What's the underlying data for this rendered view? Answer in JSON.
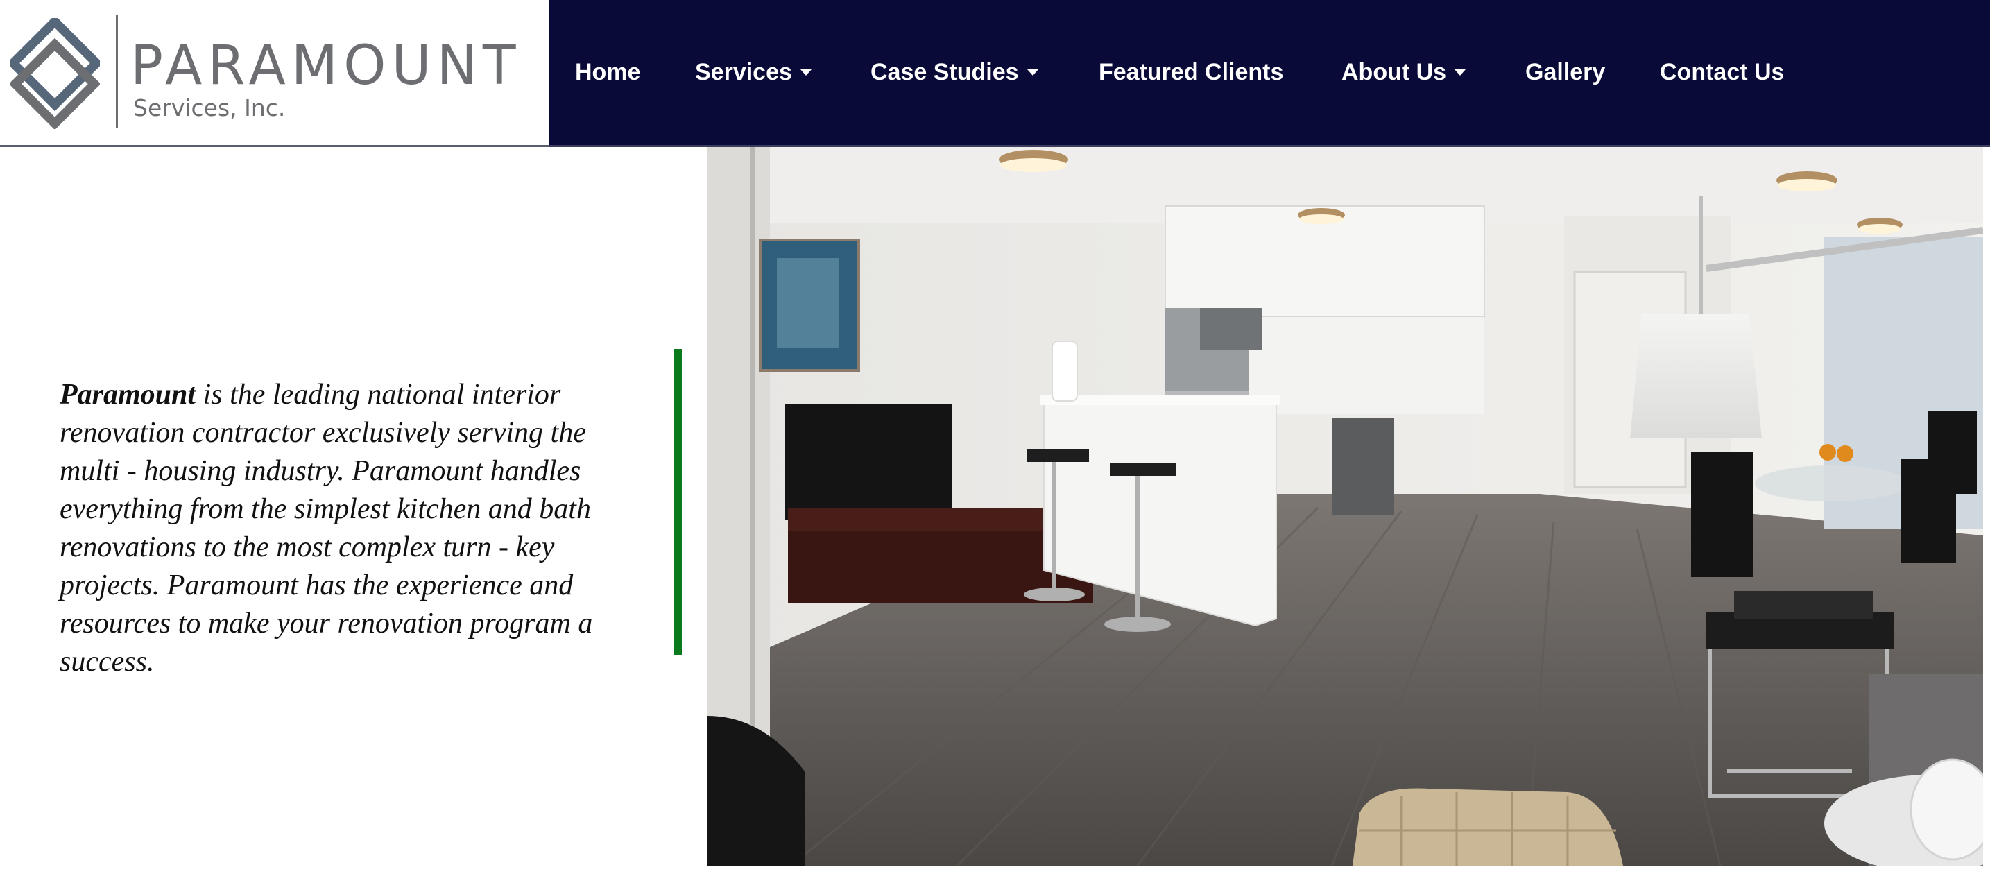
{
  "brand": {
    "name": "PARAMOUNT",
    "subtitle": "Services, Inc.",
    "colors": {
      "logo_gray": "#6d6e71",
      "nav_bg": "#0a0a39",
      "accent_green": "#0a7a1c"
    }
  },
  "nav": {
    "items": [
      {
        "label": "Home",
        "has_dropdown": false
      },
      {
        "label": "Services",
        "has_dropdown": true
      },
      {
        "label": "Case Studies",
        "has_dropdown": true
      },
      {
        "label": "Featured Clients",
        "has_dropdown": false
      },
      {
        "label": "About Us",
        "has_dropdown": true
      },
      {
        "label": "Gallery",
        "has_dropdown": false
      },
      {
        "label": "Contact Us",
        "has_dropdown": false
      }
    ],
    "dropdown_icon": "caret-down-icon"
  },
  "intro": {
    "brand_word": "Paramount",
    "text": " is the leading national interior renovation contractor exclusively serving the multi - housing industry. Paramount handles everything from the simplest kitchen and bath renovations to the most complex turn - key projects. Paramount has the experience and resources to make your renovation program a success."
  },
  "hero_image": {
    "subject": "apartment-interior-photo"
  }
}
